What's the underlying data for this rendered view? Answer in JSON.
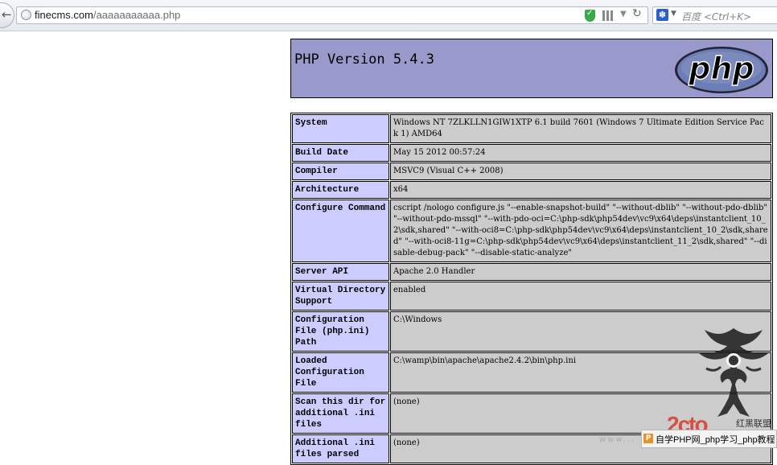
{
  "browser": {
    "url_domain": "finecms.com",
    "url_path": "/aaaaaaaaaaa.php",
    "search_placeholder": "百度 <Ctrl+K>",
    "reload_glyph": "↻",
    "back_glyph": "←"
  },
  "phpinfo": {
    "title": "PHP Version 5.4.3",
    "logo_text": "php",
    "rows": [
      {
        "key": "System",
        "value": "Windows NT 7ZLKLLN1GIW1XTP 6.1 build 7601 (Windows 7 Ultimate Edition Service Pack 1) AMD64"
      },
      {
        "key": "Build Date",
        "value": "May 15 2012 00:57:24"
      },
      {
        "key": "Compiler",
        "value": "MSVC9 (Visual C++ 2008)"
      },
      {
        "key": "Architecture",
        "value": "x64"
      },
      {
        "key": "Configure Command",
        "value": "cscript /nologo configure.js \"--enable-snapshot-build\" \"--without-dblib\" \"--without-pdo-dblib\" \"--without-pdo-mssql\" \"--with-pdo-oci=C:\\php-sdk\\php54dev\\vc9\\x64\\deps\\instantclient_10_2\\sdk,shared\" \"--with-oci8=C:\\php-sdk\\php54dev\\vc9\\x64\\deps\\instantclient_10_2\\sdk,shared\" \"--with-oci8-11g=C:\\php-sdk\\php54dev\\vc9\\x64\\deps\\instantclient_11_2\\sdk,shared\" \"--disable-debug-pack\" \"--disable-static-analyze\""
      },
      {
        "key": "Server API",
        "value": "Apache 2.0 Handler"
      },
      {
        "key": "Virtual Directory Support",
        "value": "enabled"
      },
      {
        "key": "Configuration File (php.ini) Path",
        "value": "C:\\Windows"
      },
      {
        "key": "Loaded Configuration File",
        "value": "C:\\wamp\\bin\\apache\\apache2.4.2\\bin\\php.ini"
      },
      {
        "key": "Scan this dir for additional .ini files",
        "value": "(none)"
      },
      {
        "key": "Additional .ini files parsed",
        "value": "(none)"
      }
    ]
  },
  "watermark": {
    "logo": "2cto",
    "caption": "红黑联盟",
    "bottom_link": "自学PHP网_php学习_php教程",
    "bottom_icon": "P",
    "faint_text": "www..."
  }
}
